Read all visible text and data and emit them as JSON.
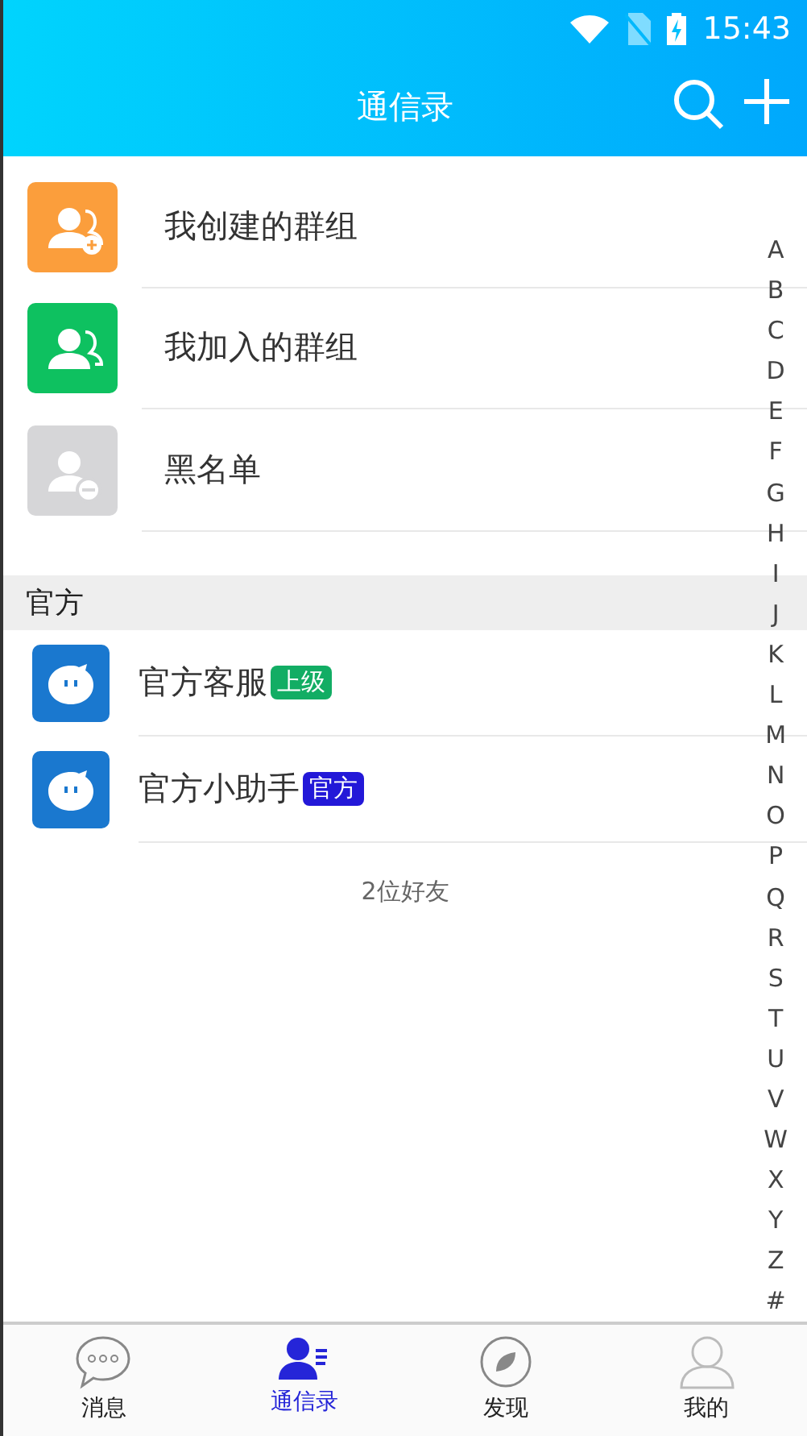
{
  "status_bar": {
    "time": "15:43"
  },
  "header": {
    "title": "通信录"
  },
  "groups": [
    {
      "kind": "create",
      "label": "我创建的群组"
    },
    {
      "kind": "joined",
      "label": "我加入的群组"
    },
    {
      "kind": "blacklist",
      "label": "黑名单"
    }
  ],
  "section": {
    "title": "官方"
  },
  "contacts": [
    {
      "name": "官方客服",
      "badge": {
        "text": "上级",
        "color": "#12ad64"
      }
    },
    {
      "name": "官方小助手",
      "badge": {
        "text": "官方",
        "color": "#2318d8"
      }
    }
  ],
  "friend_count": "2位好友",
  "index_letters": [
    "A",
    "B",
    "C",
    "D",
    "E",
    "F",
    "G",
    "H",
    "I",
    "J",
    "K",
    "L",
    "M",
    "N",
    "O",
    "P",
    "Q",
    "R",
    "S",
    "T",
    "U",
    "V",
    "W",
    "X",
    "Y",
    "Z",
    "#"
  ],
  "tabs": [
    {
      "kind": "chat",
      "label": "消息",
      "selected": false
    },
    {
      "kind": "contacts",
      "label": "通信录",
      "selected": true
    },
    {
      "kind": "discover",
      "label": "发现",
      "selected": false
    },
    {
      "kind": "me",
      "label": "我的",
      "selected": false
    }
  ]
}
